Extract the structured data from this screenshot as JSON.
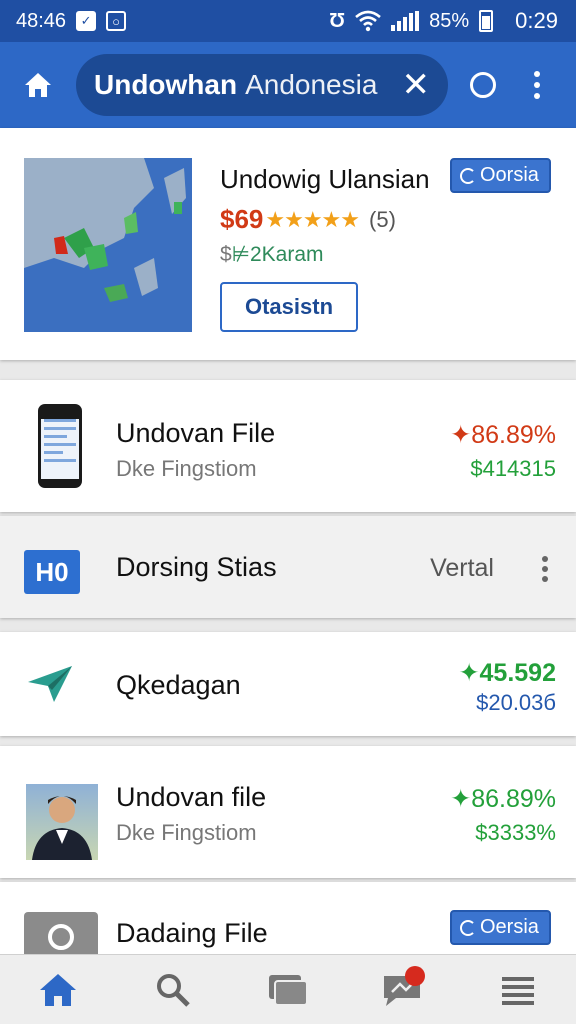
{
  "status_bar": {
    "time_left": "48:46",
    "battery": "85%",
    "clock": "0:29",
    "bg_color": "#1f4fa3"
  },
  "app_bar": {
    "search_bold": "Undowhan",
    "search_rest": "Andonesia",
    "bg_color": "#2d68c6"
  },
  "featured": {
    "title": "Undowig Ulansian",
    "badge": "Oorsia",
    "price": "$69",
    "stars": "★★★★★",
    "rating_count": "(5)",
    "sub_prefix": "$",
    "sub_text": "⊭2Karam",
    "action_label": "Otasistn"
  },
  "rows": [
    {
      "title": "Undovan File",
      "sub": "Dke Fingstiom",
      "change": "✦86.89%",
      "amount": "$414315"
    },
    {
      "title": "Dorsing Stias",
      "right_label": "Vertal",
      "icon_text": "H0"
    },
    {
      "title": "Qkedagan",
      "change": "✦45.592",
      "amount": "$20.03б"
    },
    {
      "title": "Undovan file",
      "sub": "Dke Fingstiom",
      "change": "✦86.89%",
      "amount": "$3333%"
    },
    {
      "title": "Dadaing File",
      "badge": "Oersia"
    }
  ],
  "bottom_nav": [
    {
      "icon": "home-icon"
    },
    {
      "icon": "search-icon"
    },
    {
      "icon": "windows-icon"
    },
    {
      "icon": "messages-icon"
    },
    {
      "icon": "menu-icon"
    }
  ],
  "colors": {
    "accent": "#2d68c6",
    "negative": "#d13a16",
    "positive": "#23a03a",
    "stars": "#f2a019"
  }
}
